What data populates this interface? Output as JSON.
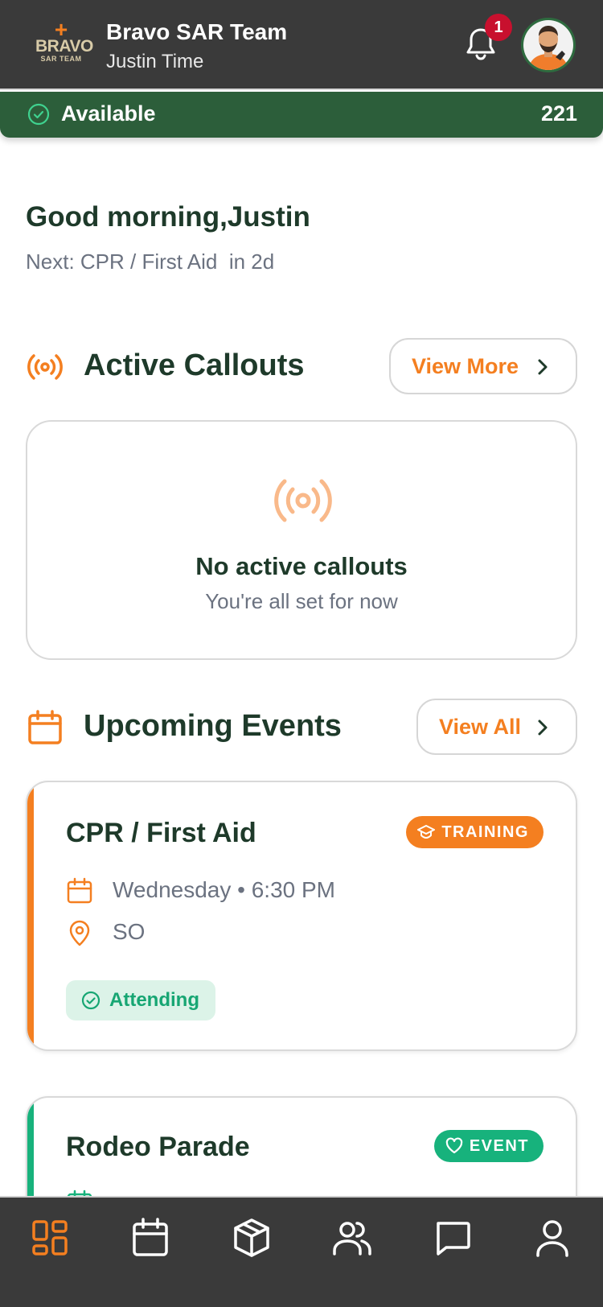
{
  "header": {
    "logo": {
      "plus": "+",
      "word": "BRAVO",
      "sub": "SAR TEAM"
    },
    "team_name": "Bravo SAR Team",
    "user_name": "Justin Time",
    "notification_count": "1"
  },
  "status": {
    "label": "Available",
    "count": "221"
  },
  "greeting": {
    "text": "Good morning,Justin",
    "next": "Next: CPR / First Aid  in 2d"
  },
  "callouts": {
    "title": "Active Callouts",
    "view_more": "View More",
    "empty_title": "No active callouts",
    "empty_sub": "You're all set for now"
  },
  "events": {
    "title": "Upcoming Events",
    "view_all": "View All",
    "items": [
      {
        "title": "CPR / First Aid",
        "tag": "TRAINING",
        "when": "Wednesday • 6:30 PM",
        "where": "SO",
        "rsvp": "Attending"
      },
      {
        "title": "Rodeo Parade",
        "tag": "EVENT"
      }
    ]
  },
  "nav": {
    "items": [
      "dashboard-icon",
      "calendar-icon",
      "inventory-icon",
      "team-icon",
      "messages-icon",
      "profile-icon"
    ],
    "active": "dashboard-icon"
  },
  "colors": {
    "brand_orange": "#f47f20",
    "brand_green": "#2c5e3a",
    "event_green": "#17b27c",
    "dark_header": "#3a3a3a",
    "alert_red": "#c8102e"
  }
}
